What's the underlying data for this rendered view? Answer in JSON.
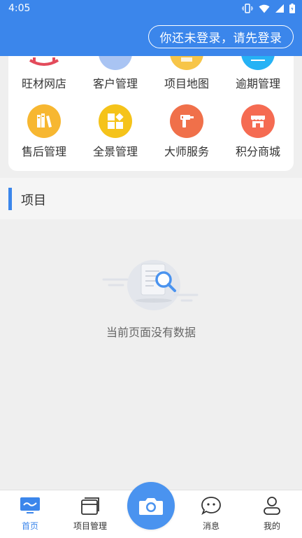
{
  "status_bar": {
    "time": "4:05"
  },
  "header": {
    "login_label": "你还未登录，请先登录"
  },
  "menu": {
    "row1": [
      {
        "label": "旺材网店",
        "icon": "shop-icon",
        "color": "#e34b5b"
      },
      {
        "label": "客户管理",
        "icon": "customer-icon",
        "color": "#8fb3f2"
      },
      {
        "label": "项目地图",
        "icon": "map-icon",
        "color": "#f7c548"
      },
      {
        "label": "逾期管理",
        "icon": "overdue-icon",
        "color": "#26b2f5"
      }
    ],
    "row2": [
      {
        "label": "售后管理",
        "icon": "books-icon",
        "color": "#f7b731"
      },
      {
        "label": "全景管理",
        "icon": "panorama-icon",
        "color": "#f5c31a"
      },
      {
        "label": "大师服务",
        "icon": "drill-icon",
        "color": "#f0704a"
      },
      {
        "label": "积分商城",
        "icon": "store-icon",
        "color": "#f56b52"
      }
    ]
  },
  "section": {
    "title": "项目"
  },
  "empty_state": {
    "message": "当前页面没有数据"
  },
  "tabbar": {
    "home": "首页",
    "projects": "项目管理",
    "messages": "消息",
    "mine": "我的"
  },
  "colors": {
    "brand": "#3b86eb",
    "background": "#efefef"
  }
}
